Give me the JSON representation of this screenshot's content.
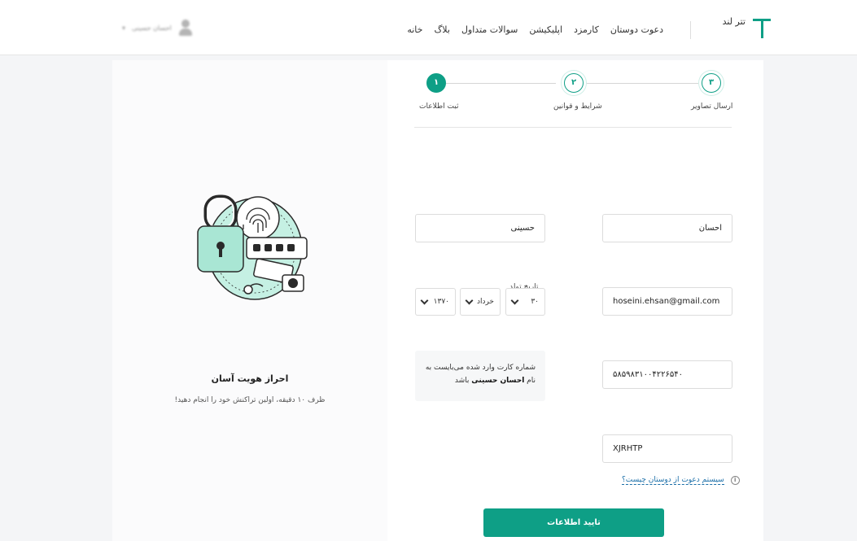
{
  "header": {
    "logo_text": "تتر لند",
    "nav": [
      "خانه",
      "بلاگ",
      "سوالات متداول",
      "اپلیکیشن",
      "کارمزد",
      "دعوت دوستان"
    ],
    "user_name": "احسان حسینی"
  },
  "steps": [
    {
      "number": "۳",
      "label": "ارسال تصاویر"
    },
    {
      "number": "۲",
      "label": "شرایط و قوانین"
    },
    {
      "number": "۱",
      "label": "ثبت اطلاعات",
      "active": true
    }
  ],
  "form": {
    "first_name": "احسان",
    "last_name": "حسینی",
    "email": "hoseini.ehsan@gmail.com",
    "dob_label": "تاریخ تولد",
    "dob_day": "۳۰",
    "dob_month": "خرداد",
    "dob_year": "۱۳۷۰",
    "card_number": "۵۸۵۹۸۳۱۰۰۴۲۲۶۵۴۰",
    "card_notice_1": "شماره کارت وارد شده می‌بایست به نام",
    "card_notice_name": "احسان حسینی",
    "card_notice_2": "باشد",
    "invite_code": "XJRHTP",
    "invite_help": "سیستم دعوت از دوستان چیست؟",
    "submit_label": "تایید اطلاعات"
  },
  "side_panel": {
    "title": "احراز هویت آسان",
    "subtitle": "ظرف ۱۰ دقیقه، اولین تراکنش خود را انجام دهید!"
  },
  "colors": {
    "accent": "#0e9f86",
    "accent_light": "#bfeee2"
  },
  "icons": [
    "info-icon",
    "chevron-down-icon",
    "user-icon"
  ]
}
